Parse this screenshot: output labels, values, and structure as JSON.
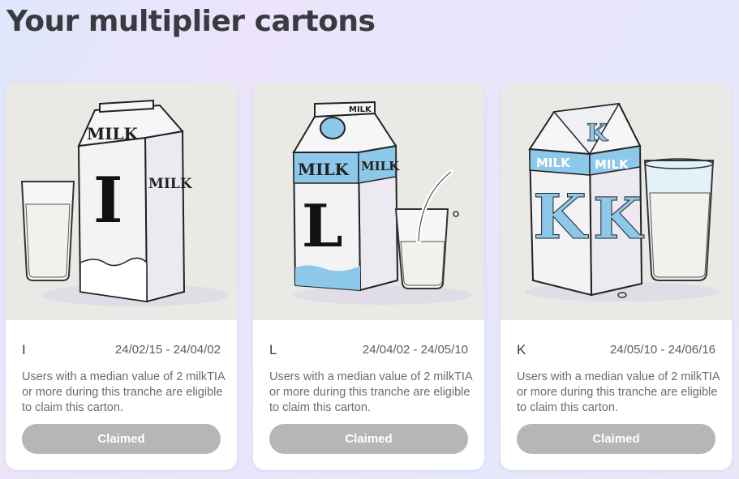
{
  "page": {
    "title": "Your multiplier cartons"
  },
  "cards": [
    {
      "letter": "I",
      "carton_text": "MILK",
      "dates": "24/02/15 - 24/04/02",
      "description": "Users with a median value of 2 milkTIA or more during this tranche are eligible to claim this carton.",
      "button_label": "Claimed"
    },
    {
      "letter": "L",
      "carton_text": "MILK",
      "dates": "24/04/02 - 24/05/10",
      "description": "Users with a median value of 2 milkTIA or more during this tranche are eligible to claim this carton.",
      "button_label": "Claimed"
    },
    {
      "letter": "K",
      "carton_text": "MILK",
      "dates": "24/05/10 - 24/06/16",
      "description": "Users with a median value of 2 milkTIA or more during this tranche are eligible to claim this carton.",
      "button_label": "Claimed"
    }
  ],
  "colors": {
    "milk_blue": "#8cc8ea",
    "button_disabled": "#b6b6b8"
  }
}
